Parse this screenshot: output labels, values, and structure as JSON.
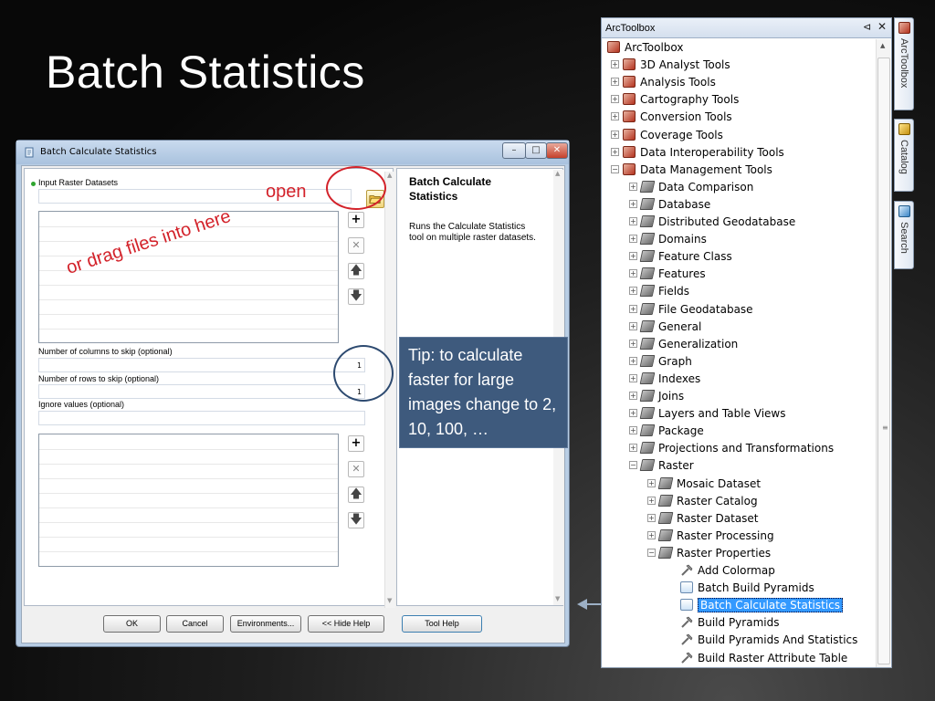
{
  "slide": {
    "title": "Batch Statistics"
  },
  "dialog": {
    "title": "Batch Calculate Statistics",
    "input_label": "Input Raster Datasets",
    "columns_label": "Number of columns to skip (optional)",
    "columns_value": "1",
    "rows_label": "Number of rows to skip (optional)",
    "rows_value": "1",
    "ignore_label": "Ignore values (optional)",
    "buttons": {
      "ok": "OK",
      "cancel": "Cancel",
      "environments": "Environments...",
      "hide_help": "<< Hide Help",
      "tool_help": "Tool Help"
    },
    "help": {
      "title": "Batch Calculate Statistics",
      "body": "Runs the Calculate Statistics tool on multiple raster datasets."
    }
  },
  "annotations": {
    "open": "open",
    "drag": "or drag files into here",
    "tip": "Tip: to calculate faster for large images change to 2, 10, 100, …"
  },
  "toolbox": {
    "title": "ArcToolbox",
    "root": "ArcToolbox",
    "toolboxes": [
      "3D Analyst Tools",
      "Analysis Tools",
      "Cartography Tools",
      "Conversion Tools",
      "Coverage Tools",
      "Data Interoperability Tools",
      "Data Management Tools"
    ],
    "dm_toolsets": [
      "Data Comparison",
      "Database",
      "Distributed Geodatabase",
      "Domains",
      "Feature Class",
      "Features",
      "Fields",
      "File Geodatabase",
      "General",
      "Generalization",
      "Graph",
      "Indexes",
      "Joins",
      "Layers and Table Views",
      "Package",
      "Projections and Transformations",
      "Raster"
    ],
    "raster_toolsets": [
      "Mosaic Dataset",
      "Raster Catalog",
      "Raster Dataset",
      "Raster Processing",
      "Raster Properties"
    ],
    "raster_properties_tools": [
      "Add Colormap",
      "Batch Build Pyramids",
      "Batch Calculate Statistics",
      "Build Pyramids",
      "Build Pyramids And Statistics",
      "Build Raster Attribute Table"
    ],
    "selected_tool": "Batch Calculate Statistics"
  },
  "side_tabs": [
    "ArcToolbox",
    "Catalog",
    "Search"
  ],
  "colors": {
    "annotation_red": "#d3222a",
    "tip_blue": "#3e5a7d",
    "selection": "#3399ff"
  }
}
